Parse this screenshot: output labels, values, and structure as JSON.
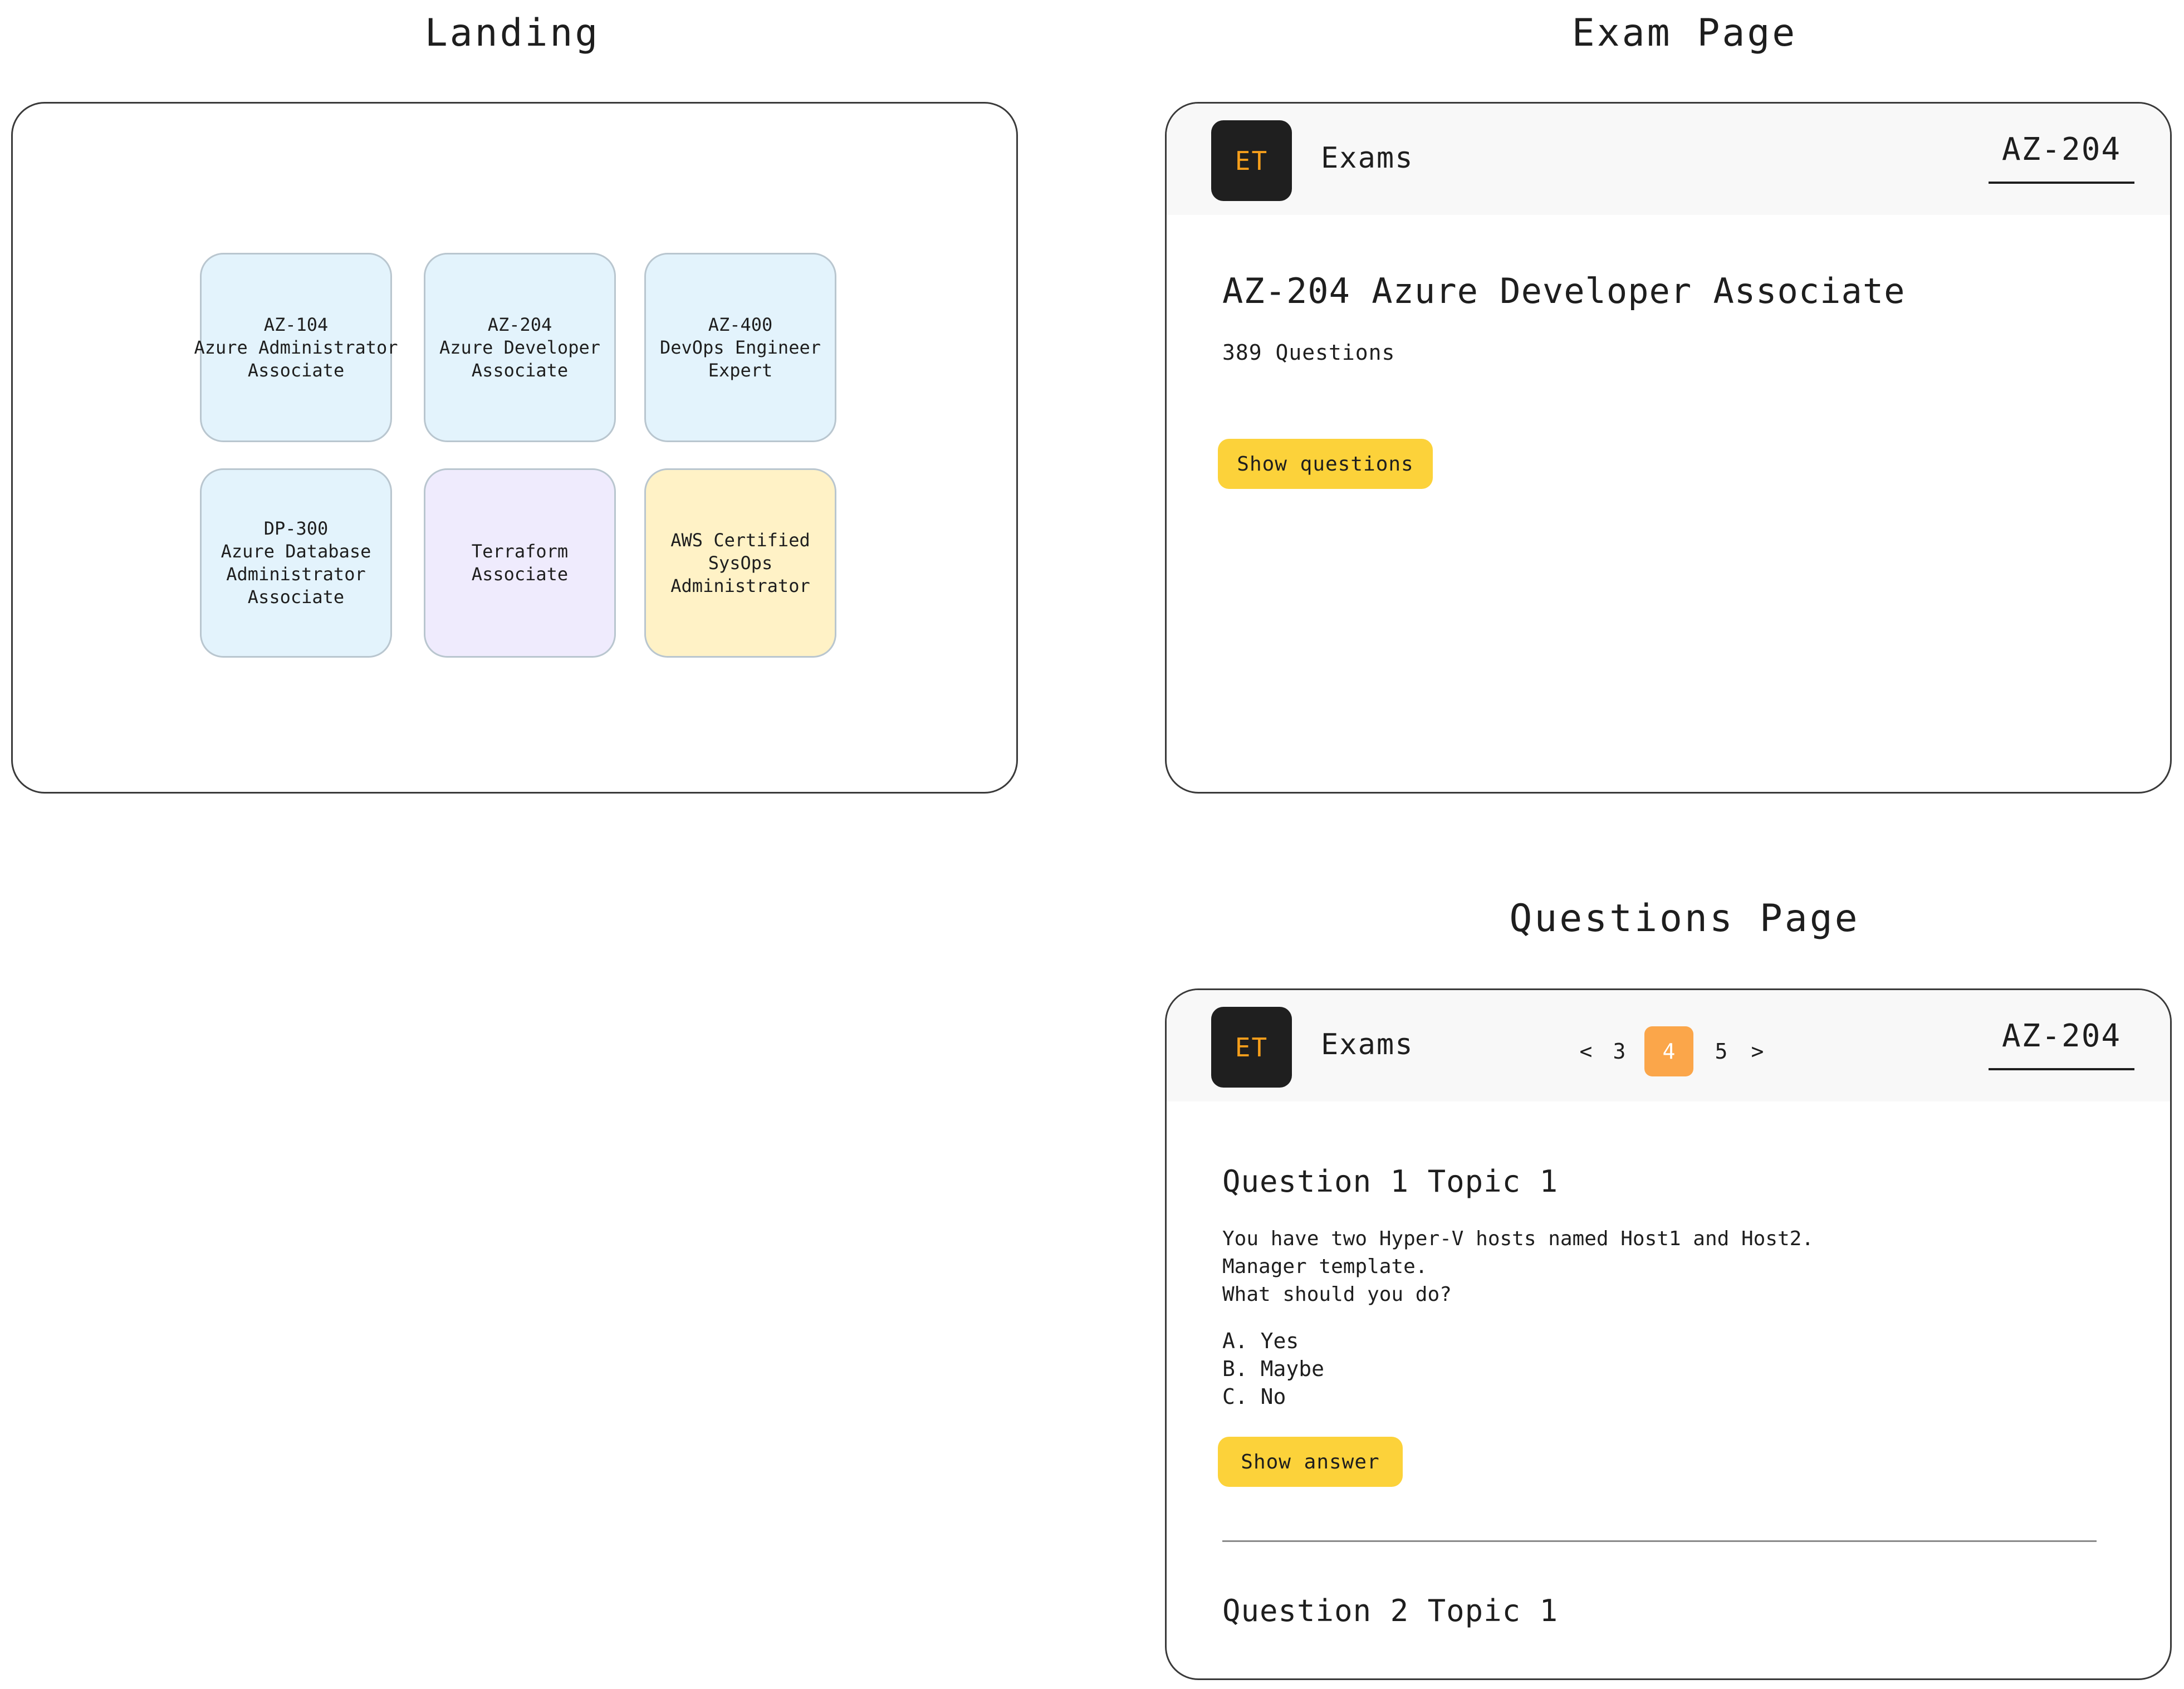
{
  "sections": {
    "landing_title": "Landing",
    "exam_title": "Exam Page",
    "questions_title": "Questions Page"
  },
  "landing": {
    "tiles": [
      {
        "lines": [
          "AZ-104",
          "Azure Administrator",
          "Associate"
        ],
        "color": "#e3f3fc"
      },
      {
        "lines": [
          "AZ-204",
          "Azure Developer",
          "Associate"
        ],
        "color": "#e3f3fc"
      },
      {
        "lines": [
          "AZ-400",
          "DevOps Engineer",
          "Expert"
        ],
        "color": "#e3f3fc"
      },
      {
        "lines": [
          "DP-300",
          "Azure Database",
          "Administrator",
          "Associate"
        ],
        "color": "#e3f3fc"
      },
      {
        "lines": [
          "Terraform",
          "Associate"
        ],
        "color": "#efebfd"
      },
      {
        "lines": [
          "AWS Certified",
          "SysOps",
          "Administrator"
        ],
        "color": "#fff2c6"
      }
    ]
  },
  "header": {
    "logo_text": "ET",
    "brand": "Exams",
    "exam_code": "AZ-204"
  },
  "exam_page": {
    "title": "AZ-204 Azure Developer Associate",
    "question_count": "389 Questions",
    "show_questions_label": "Show questions"
  },
  "questions_page": {
    "pagination": {
      "prev": "<",
      "pages": [
        "3",
        "4",
        "5"
      ],
      "current": "4",
      "next": ">"
    },
    "question1": {
      "heading": "Question 1 Topic 1",
      "text_lines": [
        "You have two Hyper-V hosts named Host1 and Host2.",
        "Manager template.",
        "What should you do?"
      ],
      "options": [
        "A. Yes",
        "B. Maybe",
        "C. No"
      ],
      "show_answer_label": "Show answer"
    },
    "question2": {
      "heading": "Question 2 Topic 1"
    }
  },
  "colors": {
    "accent_yellow": "#fcd23a",
    "active_page": "#fba64a",
    "logo_bg": "#1f1f1f",
    "logo_text": "#f59e1b"
  }
}
